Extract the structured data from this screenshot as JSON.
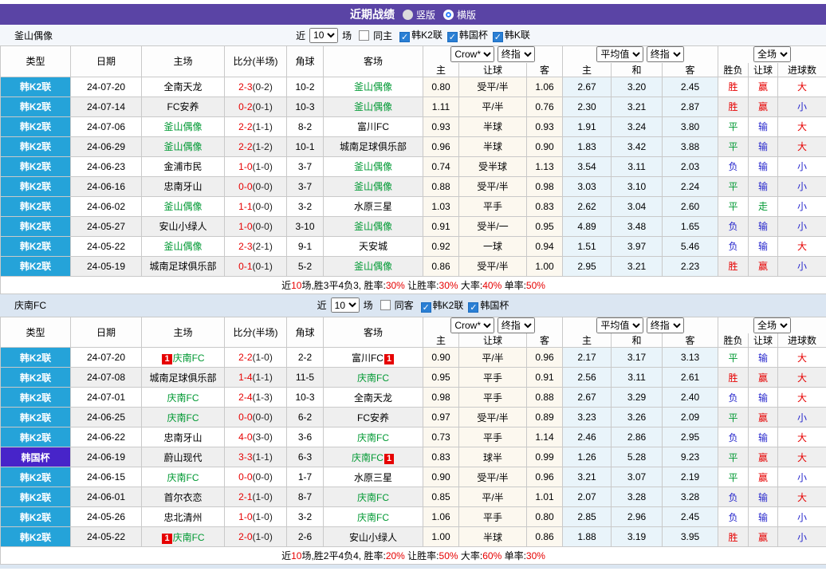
{
  "topbar": {
    "title": "近期战绩",
    "radios": [
      {
        "label": "竖版",
        "selected": true
      },
      {
        "label": "横版",
        "selected": false
      }
    ]
  },
  "header": {
    "type": "类型",
    "date": "日期",
    "home": "主场",
    "score": "比分(半场)",
    "corner": "角球",
    "away": "客场",
    "dd": {
      "crow": "Crow*",
      "final1": "终指",
      "avg": "平均值",
      "final2": "终指",
      "full": "全场"
    },
    "sub": {
      "h": "主",
      "hc": "让球",
      "a": "客",
      "avg_h": "主",
      "avg_d": "和",
      "avg_a": "客",
      "res": "胜负",
      "res_hc": "让球",
      "res_goal": "进球数"
    }
  },
  "sections": [
    {
      "team": "釜山偶像",
      "controls": {
        "prefix": "近",
        "count": "10",
        "suffix": "场",
        "same": {
          "label": "同主",
          "checked": false
        },
        "leagues": [
          {
            "label": "韩K2联",
            "checked": true
          },
          {
            "label": "韩国杯",
            "checked": true
          },
          {
            "label": "韩K联",
            "checked": true
          }
        ]
      },
      "rows": [
        {
          "type": "韩K2联",
          "cup": false,
          "date": "24-07-20",
          "home": {
            "name": "全南天龙",
            "self": false,
            "badge": false
          },
          "score": "2-3",
          "half": "(0-2)",
          "corner": "10-2",
          "away": {
            "name": "釜山偶像",
            "self": true,
            "badge": false
          },
          "crow": [
            "0.80",
            "受平/半",
            "1.06"
          ],
          "avg": [
            "2.67",
            "3.20",
            "2.45"
          ],
          "result": {
            "t": "胜",
            "c": "r"
          },
          "hcResult": {
            "t": "赢",
            "c": "r"
          },
          "goalResult": {
            "t": "大",
            "c": "r"
          }
        },
        {
          "type": "韩K2联",
          "cup": false,
          "date": "24-07-14",
          "home": {
            "name": "FC安养",
            "self": false,
            "badge": false
          },
          "score": "0-2",
          "half": "(0-1)",
          "corner": "10-3",
          "away": {
            "name": "釜山偶像",
            "self": true,
            "badge": false
          },
          "crow": [
            "1.11",
            "平/半",
            "0.76"
          ],
          "avg": [
            "2.30",
            "3.21",
            "2.87"
          ],
          "result": {
            "t": "胜",
            "c": "r"
          },
          "hcResult": {
            "t": "赢",
            "c": "r"
          },
          "goalResult": {
            "t": "小",
            "c": "b"
          }
        },
        {
          "type": "韩K2联",
          "cup": false,
          "date": "24-07-06",
          "home": {
            "name": "釜山偶像",
            "self": true,
            "badge": false
          },
          "score": "2-2",
          "half": "(1-1)",
          "corner": "8-2",
          "away": {
            "name": "富川FC",
            "self": false,
            "badge": false
          },
          "crow": [
            "0.93",
            "半球",
            "0.93"
          ],
          "avg": [
            "1.91",
            "3.24",
            "3.80"
          ],
          "result": {
            "t": "平",
            "c": "g"
          },
          "hcResult": {
            "t": "输",
            "c": "b"
          },
          "goalResult": {
            "t": "大",
            "c": "r"
          }
        },
        {
          "type": "韩K2联",
          "cup": false,
          "date": "24-06-29",
          "home": {
            "name": "釜山偶像",
            "self": true,
            "badge": false
          },
          "score": "2-2",
          "half": "(1-2)",
          "corner": "10-1",
          "away": {
            "name": "城南足球俱乐部",
            "self": false,
            "badge": false
          },
          "crow": [
            "0.96",
            "半球",
            "0.90"
          ],
          "avg": [
            "1.83",
            "3.42",
            "3.88"
          ],
          "result": {
            "t": "平",
            "c": "g"
          },
          "hcResult": {
            "t": "输",
            "c": "b"
          },
          "goalResult": {
            "t": "大",
            "c": "r"
          }
        },
        {
          "type": "韩K2联",
          "cup": false,
          "date": "24-06-23",
          "home": {
            "name": "金浦市民",
            "self": false,
            "badge": false
          },
          "score": "1-0",
          "half": "(1-0)",
          "corner": "3-7",
          "away": {
            "name": "釜山偶像",
            "self": true,
            "badge": false
          },
          "crow": [
            "0.74",
            "受半球",
            "1.13"
          ],
          "avg": [
            "3.54",
            "3.11",
            "2.03"
          ],
          "result": {
            "t": "负",
            "c": "b"
          },
          "hcResult": {
            "t": "输",
            "c": "b"
          },
          "goalResult": {
            "t": "小",
            "c": "b"
          }
        },
        {
          "type": "韩K2联",
          "cup": false,
          "date": "24-06-16",
          "home": {
            "name": "忠南牙山",
            "self": false,
            "badge": false
          },
          "score": "0-0",
          "half": "(0-0)",
          "corner": "3-7",
          "away": {
            "name": "釜山偶像",
            "self": true,
            "badge": false
          },
          "crow": [
            "0.88",
            "受平/半",
            "0.98"
          ],
          "avg": [
            "3.03",
            "3.10",
            "2.24"
          ],
          "result": {
            "t": "平",
            "c": "g"
          },
          "hcResult": {
            "t": "输",
            "c": "b"
          },
          "goalResult": {
            "t": "小",
            "c": "b"
          }
        },
        {
          "type": "韩K2联",
          "cup": false,
          "date": "24-06-02",
          "home": {
            "name": "釜山偶像",
            "self": true,
            "badge": false
          },
          "score": "1-1",
          "half": "(0-0)",
          "corner": "3-2",
          "away": {
            "name": "水原三星",
            "self": false,
            "badge": false
          },
          "crow": [
            "1.03",
            "平手",
            "0.83"
          ],
          "avg": [
            "2.62",
            "3.04",
            "2.60"
          ],
          "result": {
            "t": "平",
            "c": "g"
          },
          "hcResult": {
            "t": "走",
            "c": "g"
          },
          "goalResult": {
            "t": "小",
            "c": "b"
          }
        },
        {
          "type": "韩K2联",
          "cup": false,
          "date": "24-05-27",
          "home": {
            "name": "安山小绿人",
            "self": false,
            "badge": false
          },
          "score": "1-0",
          "half": "(0-0)",
          "corner": "3-10",
          "away": {
            "name": "釜山偶像",
            "self": true,
            "badge": false
          },
          "crow": [
            "0.91",
            "受半/一",
            "0.95"
          ],
          "avg": [
            "4.89",
            "3.48",
            "1.65"
          ],
          "result": {
            "t": "负",
            "c": "b"
          },
          "hcResult": {
            "t": "输",
            "c": "b"
          },
          "goalResult": {
            "t": "小",
            "c": "b"
          }
        },
        {
          "type": "韩K2联",
          "cup": false,
          "date": "24-05-22",
          "home": {
            "name": "釜山偶像",
            "self": true,
            "badge": false
          },
          "score": "2-3",
          "half": "(2-1)",
          "corner": "9-1",
          "away": {
            "name": "天安城",
            "self": false,
            "badge": false
          },
          "crow": [
            "0.92",
            "一球",
            "0.94"
          ],
          "avg": [
            "1.51",
            "3.97",
            "5.46"
          ],
          "result": {
            "t": "负",
            "c": "b"
          },
          "hcResult": {
            "t": "输",
            "c": "b"
          },
          "goalResult": {
            "t": "大",
            "c": "r"
          }
        },
        {
          "type": "韩K2联",
          "cup": false,
          "date": "24-05-19",
          "home": {
            "name": "城南足球俱乐部",
            "self": false,
            "badge": false
          },
          "score": "0-1",
          "half": "(0-1)",
          "corner": "5-2",
          "away": {
            "name": "釜山偶像",
            "self": true,
            "badge": false
          },
          "crow": [
            "0.86",
            "受平/半",
            "1.00"
          ],
          "avg": [
            "2.95",
            "3.21",
            "2.23"
          ],
          "result": {
            "t": "胜",
            "c": "r"
          },
          "hcResult": {
            "t": "赢",
            "c": "r"
          },
          "goalResult": {
            "t": "小",
            "c": "b"
          }
        }
      ],
      "summary": [
        {
          "t": "近",
          "red": false
        },
        {
          "t": "10",
          "red": true
        },
        {
          "t": "场,胜3平4负3, 胜率:",
          "red": false
        },
        {
          "t": "30%",
          "red": true
        },
        {
          "t": " 让胜率:",
          "red": false
        },
        {
          "t": "30%",
          "red": true
        },
        {
          "t": " 大率:",
          "red": false
        },
        {
          "t": "40%",
          "red": true
        },
        {
          "t": " 单率:",
          "red": false
        },
        {
          "t": "50%",
          "red": true
        }
      ]
    },
    {
      "team": "庆南FC",
      "controls": {
        "prefix": "近",
        "count": "10",
        "suffix": "场",
        "same": {
          "label": "同客",
          "checked": false
        },
        "leagues": [
          {
            "label": "韩K2联",
            "checked": true
          },
          {
            "label": "韩国杯",
            "checked": true
          }
        ]
      },
      "rows": [
        {
          "type": "韩K2联",
          "cup": false,
          "date": "24-07-20",
          "home": {
            "name": "庆南FC",
            "self": true,
            "badge": true
          },
          "score": "2-2",
          "half": "(1-0)",
          "corner": "2-2",
          "away": {
            "name": "富川FC",
            "self": false,
            "badge": true
          },
          "crow": [
            "0.90",
            "平/半",
            "0.96"
          ],
          "avg": [
            "2.17",
            "3.17",
            "3.13"
          ],
          "result": {
            "t": "平",
            "c": "g"
          },
          "hcResult": {
            "t": "输",
            "c": "b"
          },
          "goalResult": {
            "t": "大",
            "c": "r"
          }
        },
        {
          "type": "韩K2联",
          "cup": false,
          "date": "24-07-08",
          "home": {
            "name": "城南足球俱乐部",
            "self": false,
            "badge": false
          },
          "score": "1-4",
          "half": "(1-1)",
          "corner": "11-5",
          "away": {
            "name": "庆南FC",
            "self": true,
            "badge": false
          },
          "crow": [
            "0.95",
            "平手",
            "0.91"
          ],
          "avg": [
            "2.56",
            "3.11",
            "2.61"
          ],
          "result": {
            "t": "胜",
            "c": "r"
          },
          "hcResult": {
            "t": "赢",
            "c": "r"
          },
          "goalResult": {
            "t": "大",
            "c": "r"
          }
        },
        {
          "type": "韩K2联",
          "cup": false,
          "date": "24-07-01",
          "home": {
            "name": "庆南FC",
            "self": true,
            "badge": false
          },
          "score": "2-4",
          "half": "(1-3)",
          "corner": "10-3",
          "away": {
            "name": "全南天龙",
            "self": false,
            "badge": false
          },
          "crow": [
            "0.98",
            "平手",
            "0.88"
          ],
          "avg": [
            "2.67",
            "3.29",
            "2.40"
          ],
          "result": {
            "t": "负",
            "c": "b"
          },
          "hcResult": {
            "t": "输",
            "c": "b"
          },
          "goalResult": {
            "t": "大",
            "c": "r"
          }
        },
        {
          "type": "韩K2联",
          "cup": false,
          "date": "24-06-25",
          "home": {
            "name": "庆南FC",
            "self": true,
            "badge": false
          },
          "score": "0-0",
          "half": "(0-0)",
          "corner": "6-2",
          "away": {
            "name": "FC安养",
            "self": false,
            "badge": false
          },
          "crow": [
            "0.97",
            "受平/半",
            "0.89"
          ],
          "avg": [
            "3.23",
            "3.26",
            "2.09"
          ],
          "result": {
            "t": "平",
            "c": "g"
          },
          "hcResult": {
            "t": "赢",
            "c": "r"
          },
          "goalResult": {
            "t": "小",
            "c": "b"
          }
        },
        {
          "type": "韩K2联",
          "cup": false,
          "date": "24-06-22",
          "home": {
            "name": "忠南牙山",
            "self": false,
            "badge": false
          },
          "score": "4-0",
          "half": "(3-0)",
          "corner": "3-6",
          "away": {
            "name": "庆南FC",
            "self": true,
            "badge": false
          },
          "crow": [
            "0.73",
            "平手",
            "1.14"
          ],
          "avg": [
            "2.46",
            "2.86",
            "2.95"
          ],
          "result": {
            "t": "负",
            "c": "b"
          },
          "hcResult": {
            "t": "输",
            "c": "b"
          },
          "goalResult": {
            "t": "大",
            "c": "r"
          }
        },
        {
          "type": "韩国杯",
          "cup": true,
          "date": "24-06-19",
          "home": {
            "name": "蔚山现代",
            "self": false,
            "badge": false
          },
          "score": "3-3",
          "half": "(1-1)",
          "corner": "6-3",
          "away": {
            "name": "庆南FC",
            "self": true,
            "badge": true
          },
          "crow": [
            "0.83",
            "球半",
            "0.99"
          ],
          "avg": [
            "1.26",
            "5.28",
            "9.23"
          ],
          "result": {
            "t": "平",
            "c": "g"
          },
          "hcResult": {
            "t": "赢",
            "c": "r"
          },
          "goalResult": {
            "t": "大",
            "c": "r"
          }
        },
        {
          "type": "韩K2联",
          "cup": false,
          "date": "24-06-15",
          "home": {
            "name": "庆南FC",
            "self": true,
            "badge": false
          },
          "score": "0-0",
          "half": "(0-0)",
          "corner": "1-7",
          "away": {
            "name": "水原三星",
            "self": false,
            "badge": false
          },
          "crow": [
            "0.90",
            "受平/半",
            "0.96"
          ],
          "avg": [
            "3.21",
            "3.07",
            "2.19"
          ],
          "result": {
            "t": "平",
            "c": "g"
          },
          "hcResult": {
            "t": "赢",
            "c": "r"
          },
          "goalResult": {
            "t": "小",
            "c": "b"
          }
        },
        {
          "type": "韩K2联",
          "cup": false,
          "date": "24-06-01",
          "home": {
            "name": "首尔衣恋",
            "self": false,
            "badge": false
          },
          "score": "2-1",
          "half": "(1-0)",
          "corner": "8-7",
          "away": {
            "name": "庆南FC",
            "self": true,
            "badge": false
          },
          "crow": [
            "0.85",
            "平/半",
            "1.01"
          ],
          "avg": [
            "2.07",
            "3.28",
            "3.28"
          ],
          "result": {
            "t": "负",
            "c": "b"
          },
          "hcResult": {
            "t": "输",
            "c": "b"
          },
          "goalResult": {
            "t": "大",
            "c": "r"
          }
        },
        {
          "type": "韩K2联",
          "cup": false,
          "date": "24-05-26",
          "home": {
            "name": "忠北清州",
            "self": false,
            "badge": false
          },
          "score": "1-0",
          "half": "(1-0)",
          "corner": "3-2",
          "away": {
            "name": "庆南FC",
            "self": true,
            "badge": false
          },
          "crow": [
            "1.06",
            "平手",
            "0.80"
          ],
          "avg": [
            "2.85",
            "2.96",
            "2.45"
          ],
          "result": {
            "t": "负",
            "c": "b"
          },
          "hcResult": {
            "t": "输",
            "c": "b"
          },
          "goalResult": {
            "t": "小",
            "c": "b"
          }
        },
        {
          "type": "韩K2联",
          "cup": false,
          "date": "24-05-22",
          "home": {
            "name": "庆南FC",
            "self": true,
            "badge": true
          },
          "score": "2-0",
          "half": "(1-0)",
          "corner": "2-6",
          "away": {
            "name": "安山小绿人",
            "self": false,
            "badge": false
          },
          "crow": [
            "1.00",
            "半球",
            "0.86"
          ],
          "avg": [
            "1.88",
            "3.19",
            "3.95"
          ],
          "result": {
            "t": "胜",
            "c": "r"
          },
          "hcResult": {
            "t": "赢",
            "c": "r"
          },
          "goalResult": {
            "t": "小",
            "c": "b"
          }
        }
      ],
      "summary": [
        {
          "t": "近",
          "red": false
        },
        {
          "t": "10",
          "red": true
        },
        {
          "t": "场,胜2平4负4, 胜率:",
          "red": false
        },
        {
          "t": "20%",
          "red": true
        },
        {
          "t": " 让胜率:",
          "red": false
        },
        {
          "t": "50%",
          "red": true
        },
        {
          "t": " 大率:",
          "red": false
        },
        {
          "t": "60%",
          "red": true
        },
        {
          "t": " 单率:",
          "red": false
        },
        {
          "t": "30%",
          "red": true
        }
      ]
    }
  ]
}
